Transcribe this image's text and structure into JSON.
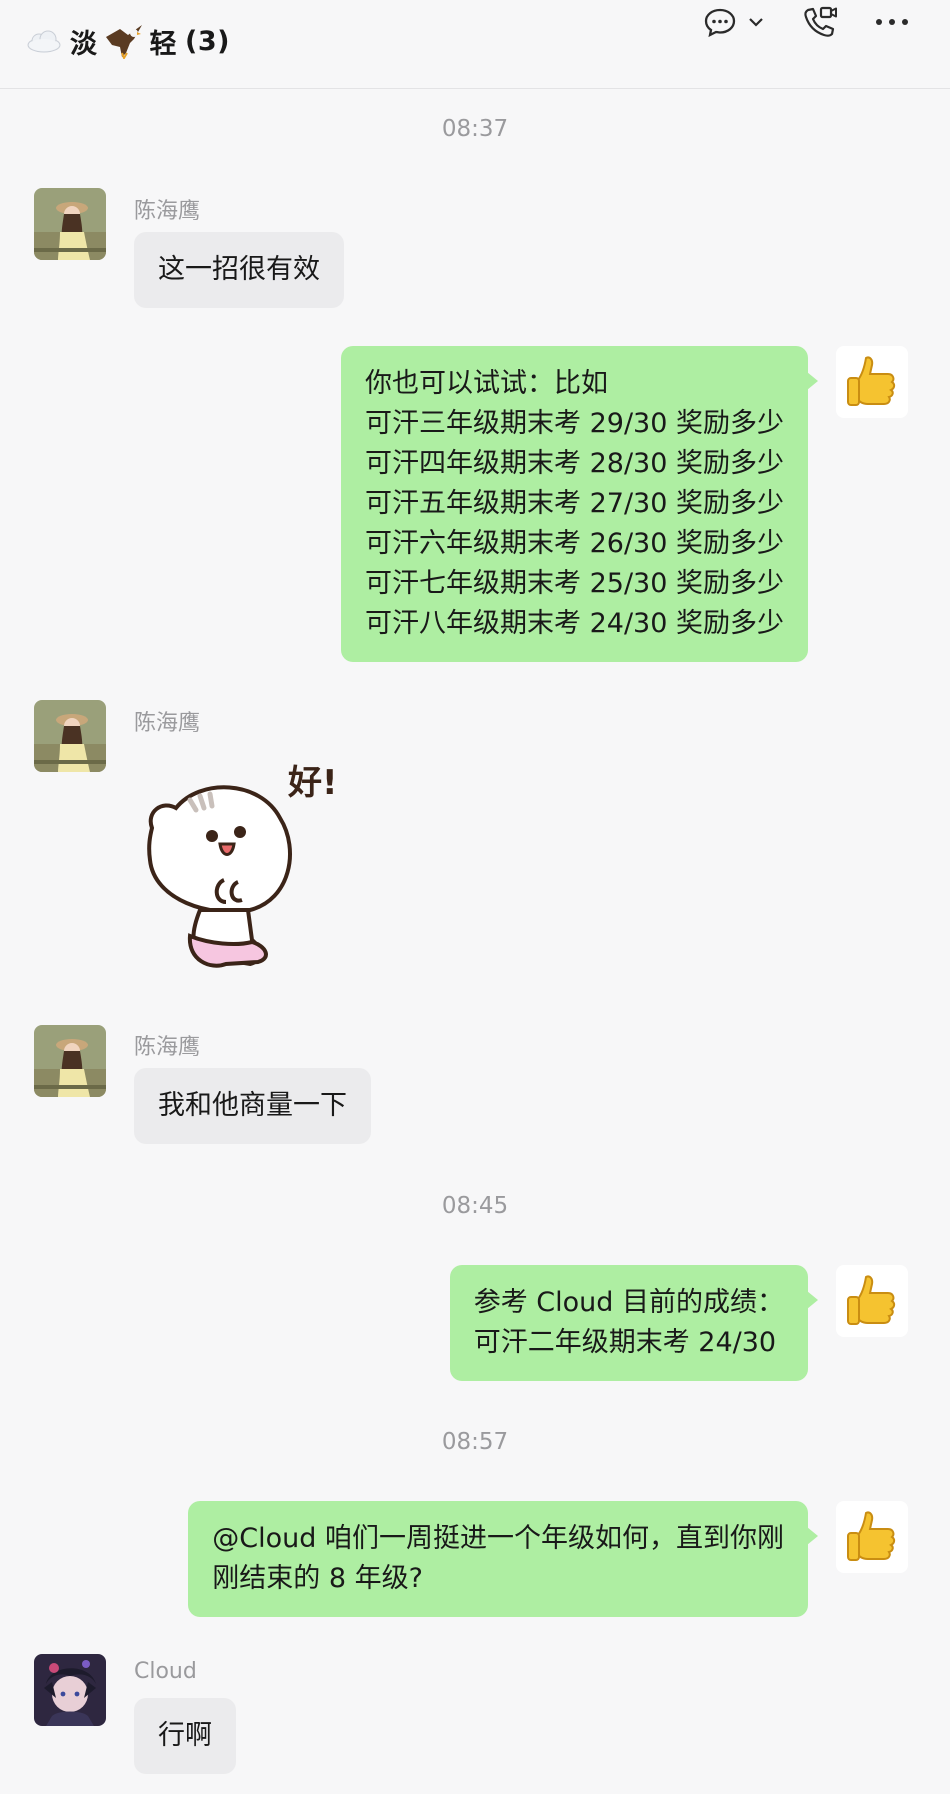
{
  "header": {
    "title_name_a": "淡",
    "title_name_b": "轻",
    "member_count": "(3)",
    "icons": [
      "cloud-emoji",
      "eagle-emoji",
      "chat-bubble-icon",
      "chevron-down-icon",
      "video-call-icon",
      "more-icon"
    ]
  },
  "messages": [
    {
      "type": "time",
      "text": "08:37"
    },
    {
      "type": "incoming",
      "sender": "陈海鹰",
      "lines": [
        "这一招很有效"
      ]
    },
    {
      "type": "outgoing",
      "lines": [
        "你也可以试试：比如",
        "可汗三年级期末考 29/30 奖励多少",
        "可汗四年级期末考 28/30 奖励多少",
        "可汗五年级期末考 27/30 奖励多少",
        "可汗六年级期末考 26/30 奖励多少",
        "可汗七年级期末考 25/30 奖励多少",
        "可汗八年级期末考 24/30 奖励多少"
      ]
    },
    {
      "type": "incoming-sticker",
      "sender": "陈海鹰",
      "sticker_text": "好!"
    },
    {
      "type": "incoming",
      "sender": "陈海鹰",
      "lines": [
        "我和他商量一下"
      ]
    },
    {
      "type": "time",
      "text": "08:45"
    },
    {
      "type": "outgoing",
      "lines": [
        "参考 Cloud 目前的成绩：",
        "可汗二年级期末考 24/30"
      ]
    },
    {
      "type": "time",
      "text": "08:57"
    },
    {
      "type": "outgoing",
      "lines": [
        "@Cloud 咱们一周挺进一个年级如何，直到你刚",
        "刚结束的 8 年级?"
      ]
    },
    {
      "type": "incoming",
      "sender": "Cloud",
      "lines": [
        "行啊"
      ]
    }
  ],
  "colors": {
    "outgoing_bubble": "#aeeea2",
    "incoming_bubble": "#ebebed",
    "background": "#f7f7f8"
  }
}
